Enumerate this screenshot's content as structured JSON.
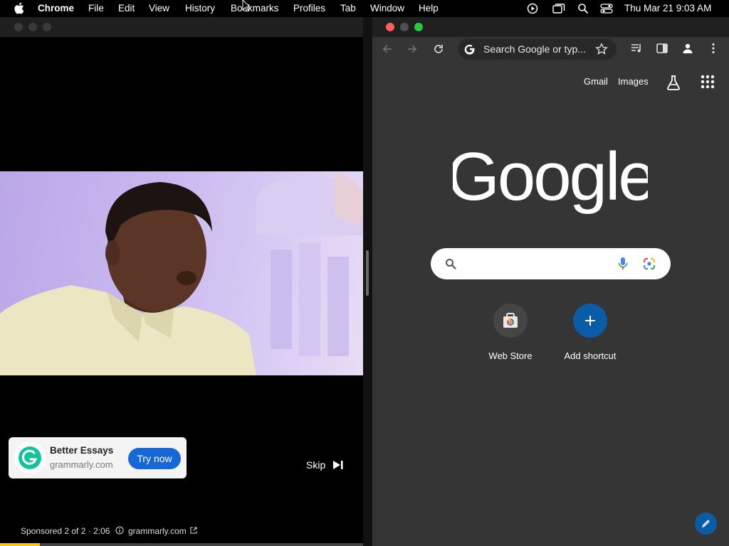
{
  "menubar": {
    "app_name": "Chrome",
    "items": [
      "File",
      "Edit",
      "View",
      "History",
      "Bookmarks",
      "Profiles",
      "Tab",
      "Window",
      "Help"
    ],
    "datetime": "Thu Mar 21  9:03 AM"
  },
  "ad": {
    "title": "Better Essays",
    "domain": "grammarly.com",
    "cta": "Try now",
    "skip_label": "Skip",
    "sponsored_text": "Sponsored 2 of 2 · 2:06",
    "footer_domain": "grammarly.com",
    "progress_fraction": 0.11
  },
  "browser": {
    "omnibox_text": "Search Google or typ...",
    "header_links": [
      "Gmail",
      "Images"
    ],
    "logo_text": "Google",
    "shortcuts": [
      {
        "label": "Web Store"
      },
      {
        "label": "Add shortcut"
      }
    ]
  },
  "icons": [
    "apple-icon",
    "play-circle-icon",
    "windows-icon",
    "search-icon",
    "control-center-icon",
    "back-icon",
    "forward-icon",
    "reload-icon",
    "google-g-icon",
    "star-icon",
    "media-icon",
    "sidepanel-icon",
    "profile-icon",
    "more-icon",
    "labs-icon",
    "apps-grid-icon",
    "mic-icon",
    "lens-icon",
    "plus-icon",
    "pencil-icon",
    "skip-icon",
    "info-icon",
    "external-link-icon"
  ],
  "colors": {
    "brand_blue": "#1668d6",
    "close": "#ff5f57",
    "minimize": "#febc2e",
    "zoom": "#28c840",
    "chrome_dark": "#353535",
    "progress": "#f5c518"
  }
}
